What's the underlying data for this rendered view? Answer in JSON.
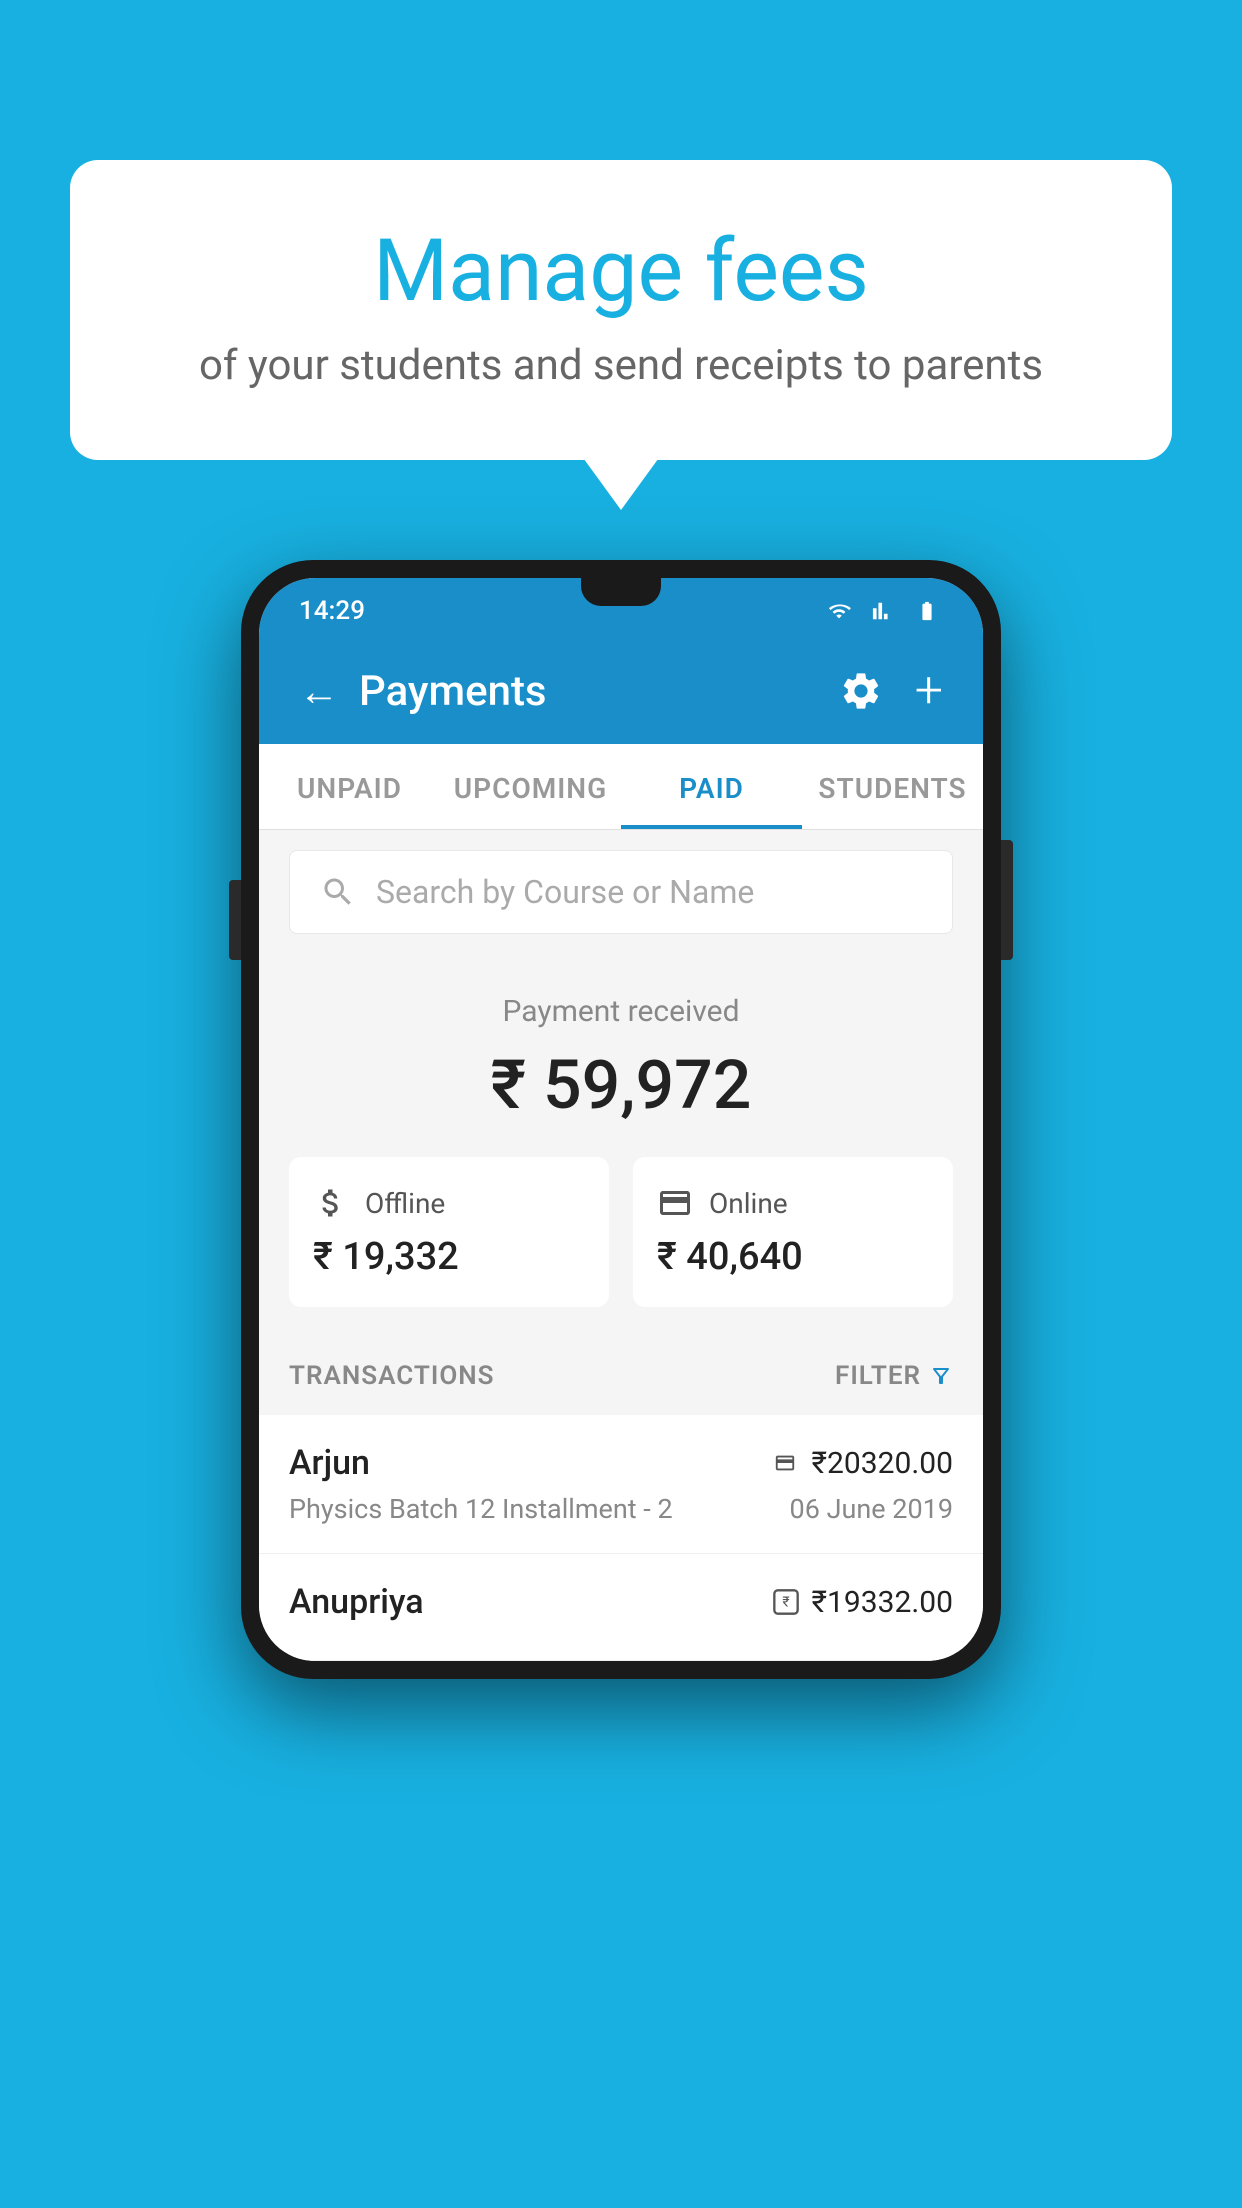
{
  "background_color": "#18b0e0",
  "speech_bubble": {
    "title": "Manage fees",
    "subtitle": "of your students and send receipts to parents"
  },
  "phone": {
    "status_bar": {
      "time": "14:29"
    },
    "header": {
      "title": "Payments",
      "back_label": "←",
      "plus_label": "+"
    },
    "tabs": [
      {
        "label": "UNPAID",
        "active": false
      },
      {
        "label": "UPCOMING",
        "active": false
      },
      {
        "label": "PAID",
        "active": true
      },
      {
        "label": "STUDENTS",
        "active": false
      }
    ],
    "search": {
      "placeholder": "Search by Course or Name"
    },
    "payment_summary": {
      "label": "Payment received",
      "total": "₹ 59,972",
      "offline_label": "Offline",
      "offline_amount": "₹ 19,332",
      "online_label": "Online",
      "online_amount": "₹ 40,640"
    },
    "transactions_section": {
      "label": "TRANSACTIONS",
      "filter_label": "FILTER"
    },
    "transactions": [
      {
        "name": "Arjun",
        "amount": "₹20320.00",
        "course": "Physics Batch 12 Installment - 2",
        "date": "06 June 2019",
        "payment_type": "card"
      },
      {
        "name": "Anupriya",
        "amount": "₹19332.00",
        "course": "",
        "date": "",
        "payment_type": "cash"
      }
    ]
  }
}
